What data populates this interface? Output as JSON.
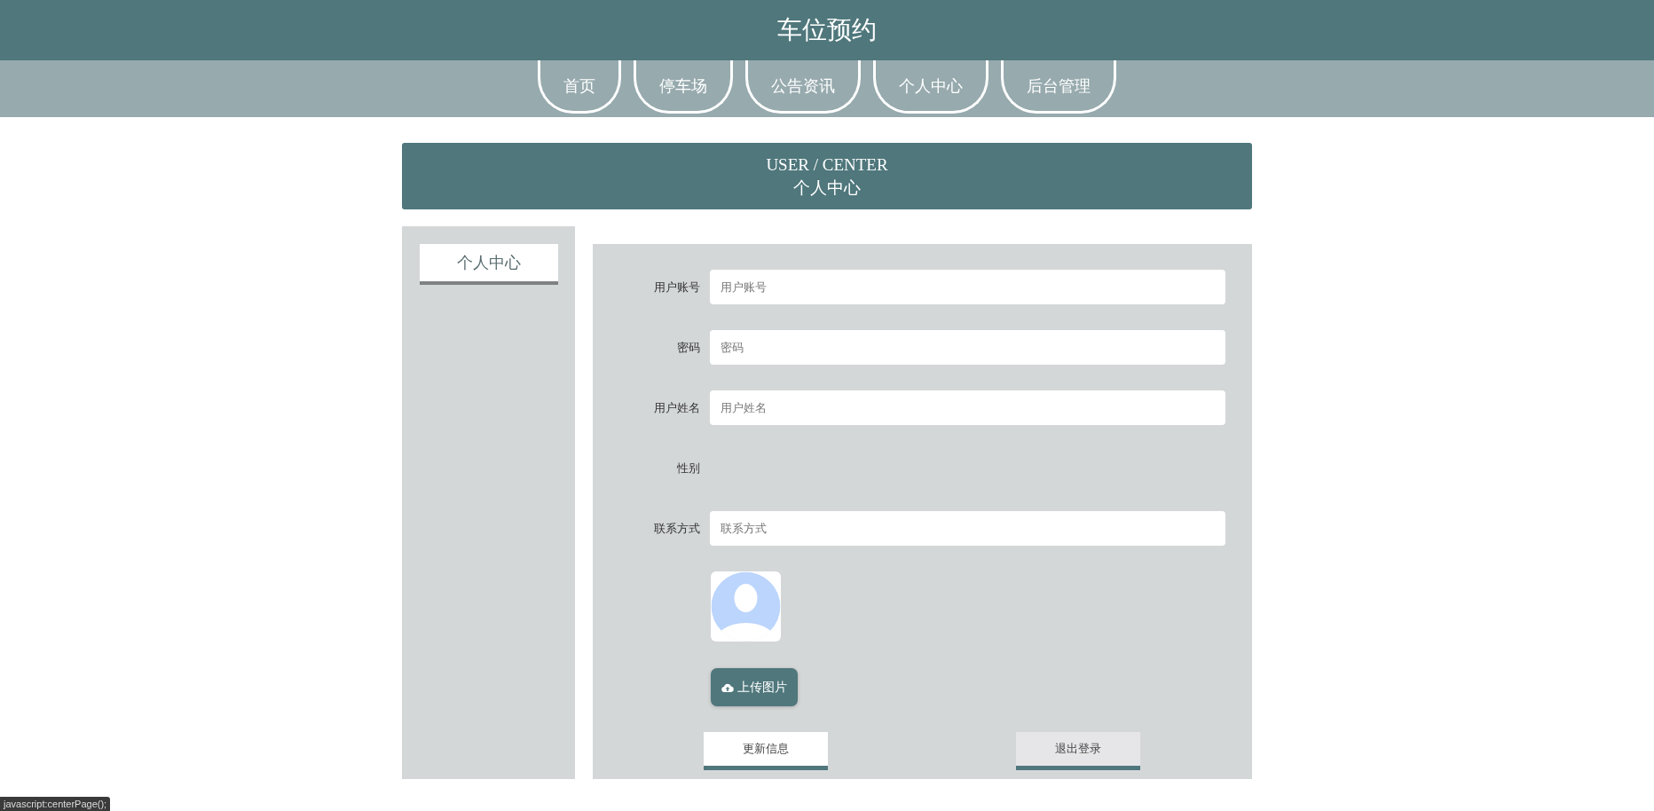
{
  "header": {
    "title": "车位预约"
  },
  "nav": [
    {
      "label": "首页"
    },
    {
      "label": "停车场"
    },
    {
      "label": "公告资讯"
    },
    {
      "label": "个人中心"
    },
    {
      "label": "后台管理"
    }
  ],
  "banner": {
    "subtitle": "USER / CENTER",
    "title": "个人中心"
  },
  "sidebar": {
    "items": [
      {
        "label": "个人中心"
      }
    ]
  },
  "form": {
    "fields": [
      {
        "kind": "input",
        "label": "用户账号",
        "placeholder": "用户账号"
      },
      {
        "kind": "input",
        "label": "密码",
        "placeholder": "密码"
      },
      {
        "kind": "input",
        "label": "用户姓名",
        "placeholder": "用户姓名"
      },
      {
        "kind": "select",
        "label": "性别"
      },
      {
        "kind": "input",
        "label": "联系方式",
        "placeholder": "联系方式"
      }
    ],
    "upload_button": "上传图片",
    "buttons": [
      {
        "label": "更新信息",
        "kind": "primary"
      },
      {
        "label": "退出登录",
        "kind": "secondary"
      }
    ]
  },
  "status_bar": "javascript:centerPage();"
}
